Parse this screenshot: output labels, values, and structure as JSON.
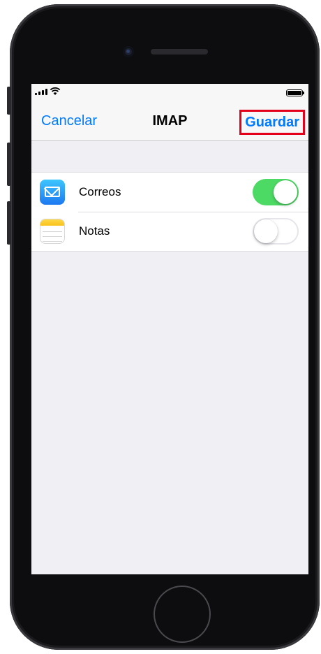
{
  "nav": {
    "cancel_label": "Cancelar",
    "title": "IMAP",
    "save_label": "Guardar"
  },
  "colors": {
    "accent": "#007aff",
    "toggle_on": "#4cd964",
    "highlight_box": "#e4001b"
  },
  "settings": [
    {
      "label": "Correos",
      "icon": "mail-icon",
      "enabled": true
    },
    {
      "label": "Notas",
      "icon": "notes-icon",
      "enabled": false
    }
  ]
}
